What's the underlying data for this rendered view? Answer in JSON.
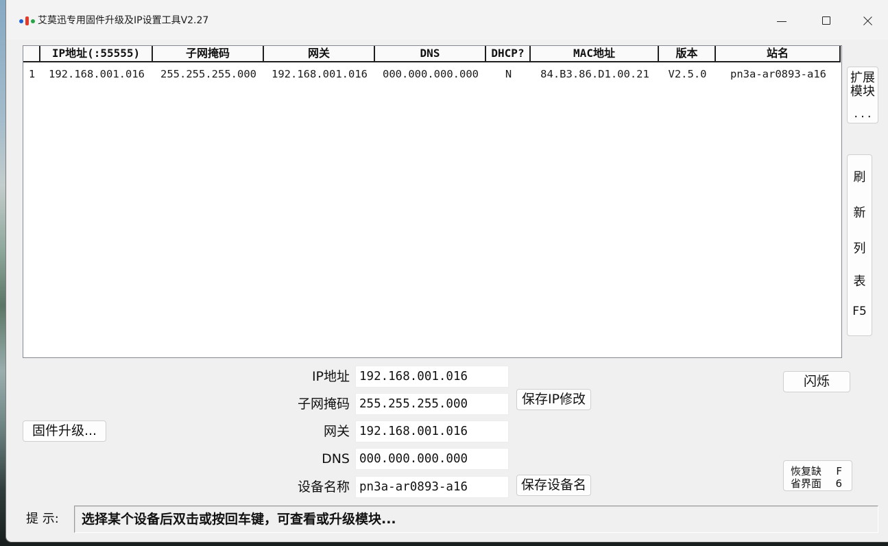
{
  "window": {
    "title": "艾莫迅专用固件升级及IP设置工具V2.27",
    "icons": {
      "app": "app-icon",
      "minimize": "minimize-icon",
      "maximize": "maximize-icon",
      "close": "close-icon"
    }
  },
  "device_table": {
    "columns": [
      "IP地址(:55555)",
      "子网掩码",
      "网关",
      "DNS",
      "DHCP?",
      "MAC地址",
      "版本",
      "站名"
    ],
    "rows": [
      {
        "index": "1",
        "ip": "192.168.001.016",
        "subnet_mask": "255.255.255.000",
        "gateway": "192.168.001.016",
        "dns": "000.000.000.000",
        "dhcp": "N",
        "mac": "84.B3.86.D1.00.21",
        "version": "V2.5.0",
        "station_name": "pn3a-ar0893-a16"
      }
    ]
  },
  "side_buttons": {
    "expand_module": {
      "lines": [
        "扩展",
        "模块",
        "..."
      ]
    },
    "refresh_list": {
      "lines": [
        "刷",
        "新",
        "列",
        "表",
        "F5"
      ]
    }
  },
  "form": {
    "ip_address": {
      "label": "IP地址",
      "value": "192.168.001.016"
    },
    "subnet_mask": {
      "label": "子网掩码",
      "value": "255.255.255.000"
    },
    "gateway": {
      "label": "网关",
      "value": "192.168.001.016"
    },
    "dns": {
      "label": "DNS",
      "value": "000.000.000.000"
    },
    "device_name": {
      "label": "设备名称",
      "value": "pn3a-ar0893-a16"
    }
  },
  "buttons": {
    "save_ip": "保存IP修改",
    "save_device_name": "保存设备名",
    "firmware_upgrade": "固件升级...",
    "flash": "闪烁",
    "restore_defaults": {
      "lines": [
        "恢复缺",
        "省界面"
      ],
      "hotkey_lines": [
        "F",
        "6"
      ]
    }
  },
  "status_bar": {
    "label": "提 示:",
    "message": "选择某个设备后双击或按回车键，可查看或升级模块..."
  },
  "colors": {
    "window_background": "#f0f0f0",
    "list_background": "#ffffff",
    "text": "#111111"
  }
}
